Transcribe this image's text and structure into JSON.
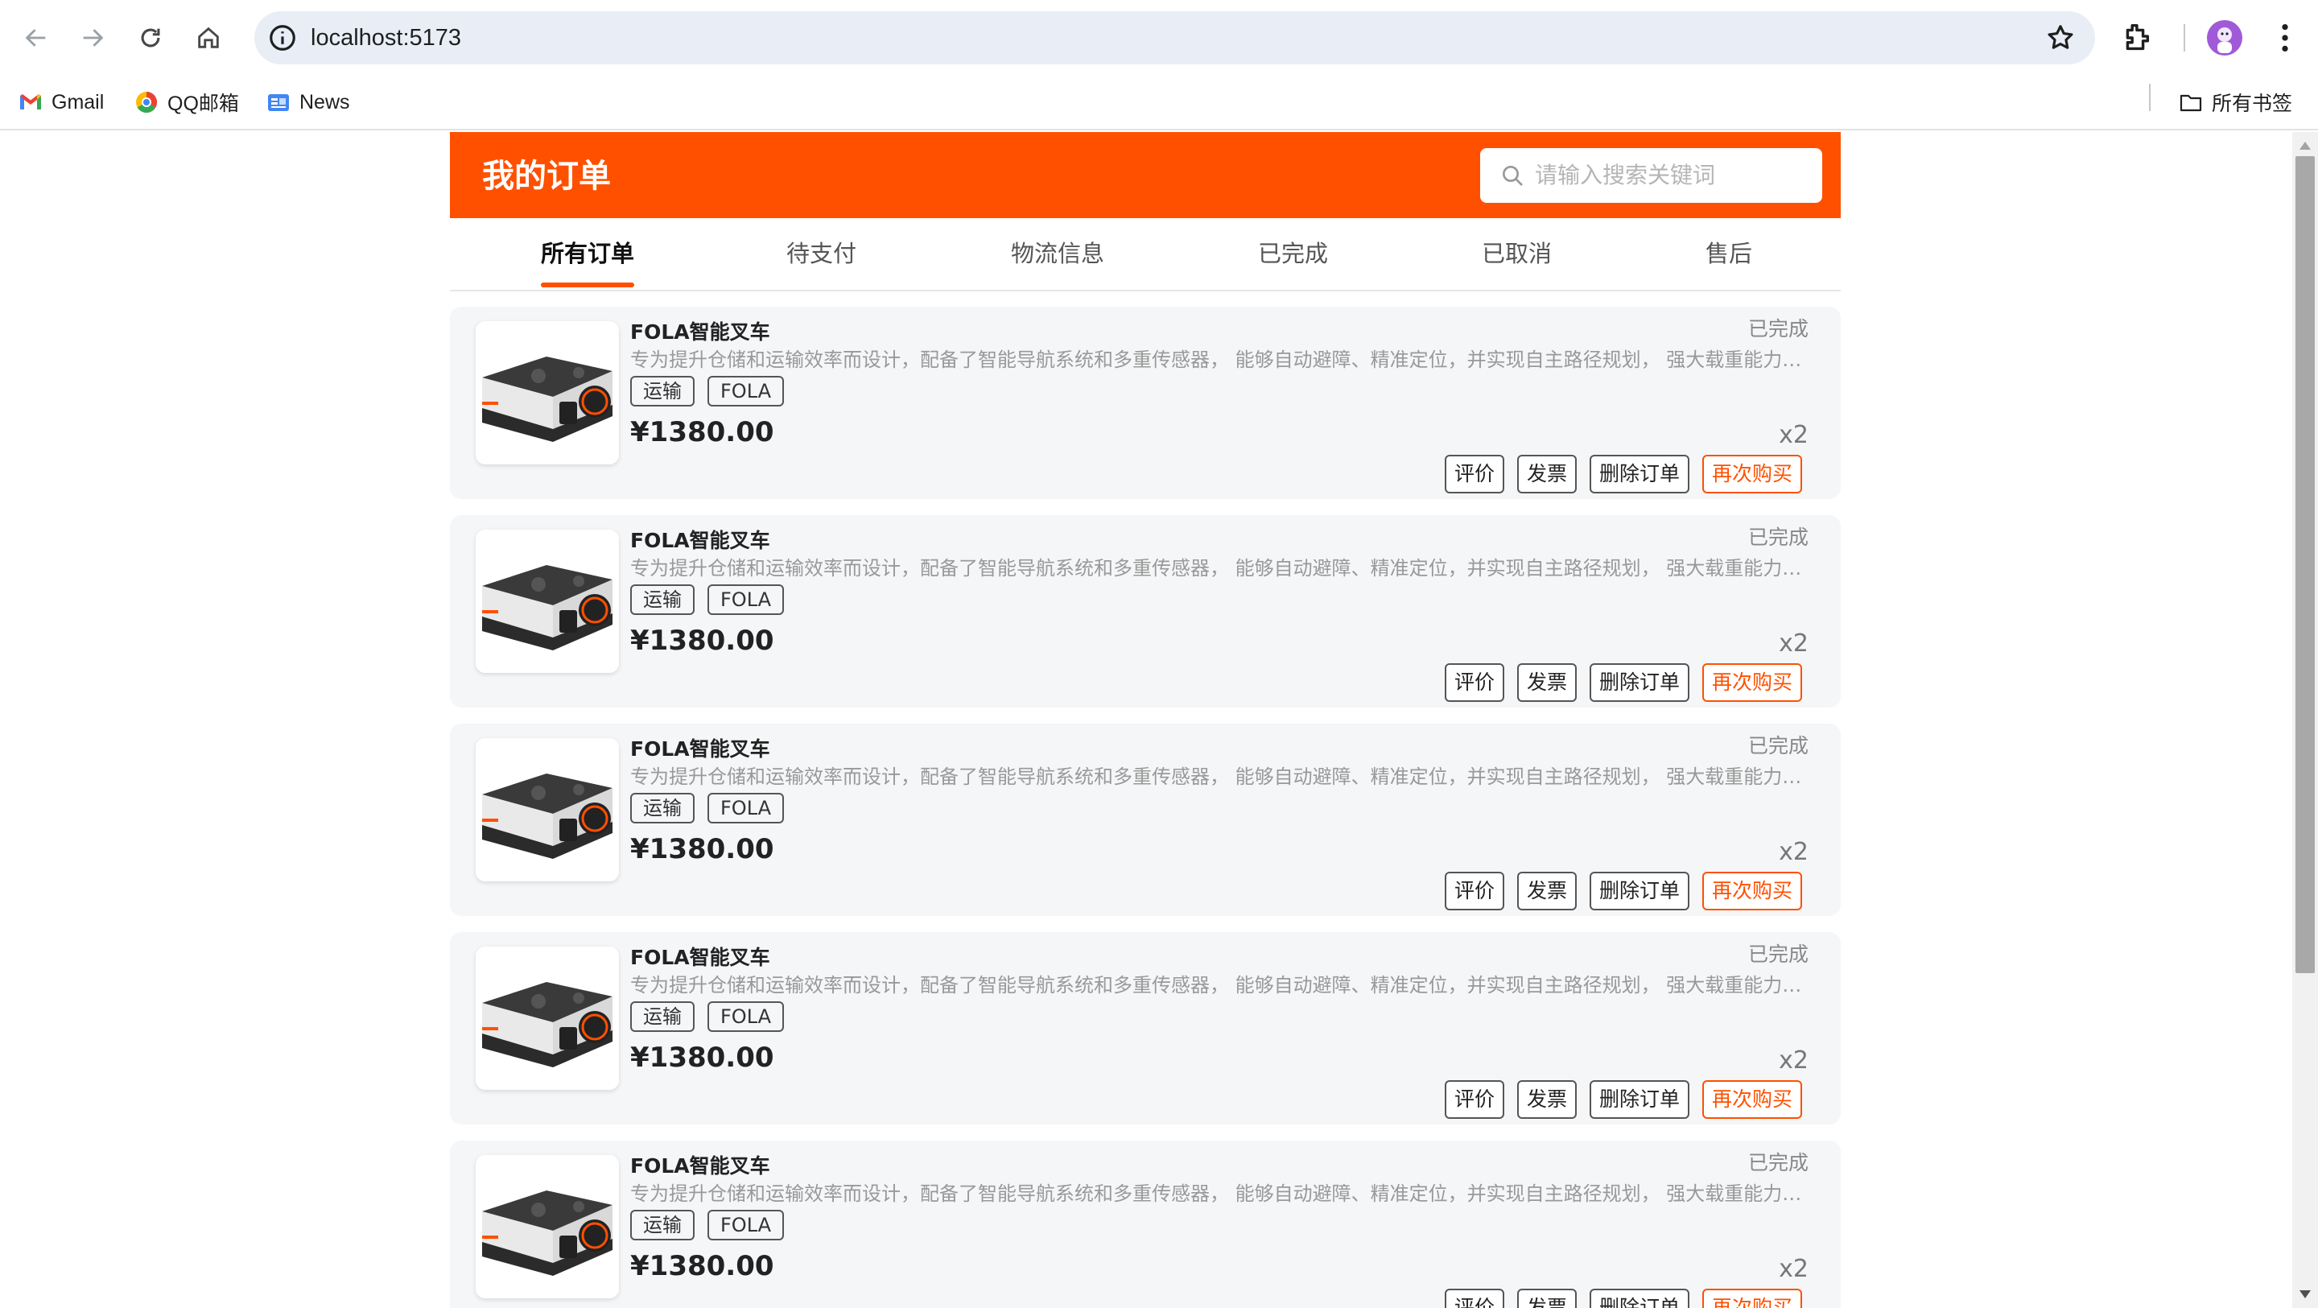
{
  "browser": {
    "url": "localhost:5173",
    "bookmarks": [
      {
        "label": "Gmail",
        "icon": "gmail-icon"
      },
      {
        "label": "QQ邮箱",
        "icon": "qqmail-icon"
      },
      {
        "label": "News",
        "icon": "news-icon"
      }
    ],
    "all_bookmarks_label": "所有书签"
  },
  "header": {
    "title": "我的订单",
    "search_placeholder": "请输入搜索关键词"
  },
  "tabs": [
    {
      "label": "所有订单",
      "active": true
    },
    {
      "label": "待支付",
      "active": false
    },
    {
      "label": "物流信息",
      "active": false
    },
    {
      "label": "已完成",
      "active": false
    },
    {
      "label": "已取消",
      "active": false
    },
    {
      "label": "售后",
      "active": false
    }
  ],
  "orders": [
    {
      "name": "FOLA智能叉车",
      "status": "已完成",
      "desc": "专为提升仓储和运输效率而设计，配备了智能导航系统和多重传感器， 能够自动避障、精准定位，并实现自主路径规划， 强大载重能力使其能够轻松搬运大型货物",
      "tags": [
        "运输",
        "FOLA"
      ],
      "price": "¥1380.00",
      "qty": "x2",
      "actions": [
        "评价",
        "发票",
        "删除订单",
        "再次购买"
      ]
    },
    {
      "name": "FOLA智能叉车",
      "status": "已完成",
      "desc": "专为提升仓储和运输效率而设计，配备了智能导航系统和多重传感器， 能够自动避障、精准定位，并实现自主路径规划， 强大载重能力使其能够轻松搬运大型货物",
      "tags": [
        "运输",
        "FOLA"
      ],
      "price": "¥1380.00",
      "qty": "x2",
      "actions": [
        "评价",
        "发票",
        "删除订单",
        "再次购买"
      ]
    },
    {
      "name": "FOLA智能叉车",
      "status": "已完成",
      "desc": "专为提升仓储和运输效率而设计，配备了智能导航系统和多重传感器， 能够自动避障、精准定位，并实现自主路径规划， 强大载重能力使其能够轻松搬运大型货物",
      "tags": [
        "运输",
        "FOLA"
      ],
      "price": "¥1380.00",
      "qty": "x2",
      "actions": [
        "评价",
        "发票",
        "删除订单",
        "再次购买"
      ]
    },
    {
      "name": "FOLA智能叉车",
      "status": "已完成",
      "desc": "专为提升仓储和运输效率而设计，配备了智能导航系统和多重传感器， 能够自动避障、精准定位，并实现自主路径规划， 强大载重能力使其能够轻松搬运大型货物",
      "tags": [
        "运输",
        "FOLA"
      ],
      "price": "¥1380.00",
      "qty": "x2",
      "actions": [
        "评价",
        "发票",
        "删除订单",
        "再次购买"
      ]
    },
    {
      "name": "FOLA智能叉车",
      "status": "已完成",
      "desc": "专为提升仓储和运输效率而设计，配备了智能导航系统和多重传感器， 能够自动避障、精准定位，并实现自主路径规划， 强大载重能力使其能够轻松搬运大型货物",
      "tags": [
        "运输",
        "FOLA"
      ],
      "price": "¥1380.00",
      "qty": "x2",
      "actions": [
        "评价",
        "发票",
        "删除订单",
        "再次购买"
      ]
    }
  ],
  "colors": {
    "accent": "#ff5000",
    "card_bg": "#f5f6f8"
  }
}
